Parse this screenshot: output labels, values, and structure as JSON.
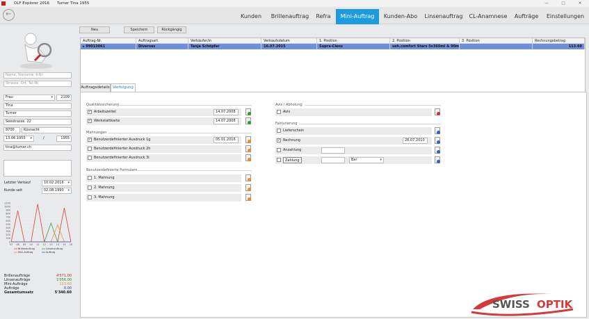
{
  "titlebar": {
    "app": "OLF Explorer 2016",
    "customer": "Turner  Tina   1955",
    "min": "—",
    "max": "□",
    "close": "✕"
  },
  "nav": {
    "back": "←",
    "tabs": [
      "Kunden",
      "Brillenauftrag",
      "Refra",
      "Mini-Auftrag",
      "Kunden-Abo",
      "Linsenauftrag",
      "CL-Anamnese",
      "Aufträge",
      "Einstellungen"
    ],
    "active": "Mini-Auftrag"
  },
  "search": {
    "name_placeholder": "Name, Vorname, K-Nr.",
    "street_placeholder": "Strasse, Ort, Tel-Nr."
  },
  "customer": {
    "salutation": "Frau",
    "number": "2109",
    "firstname": "Tina",
    "lastname": "Turner",
    "street": "Seestrasse. 22",
    "zip": "8700",
    "city": "Küsnacht",
    "birthdate": "13.06.1955",
    "slash": "/",
    "birthyear": "1955",
    "email": "tina@turner.ch"
  },
  "meta": {
    "last_sale_label": "Letzter Verkauf",
    "last_sale": "10.02.2016",
    "customer_since_label": "Kunde seit",
    "customer_since": "02.08.1990"
  },
  "chart_data": {
    "type": "line",
    "x": [
      "07",
      "08",
      "09",
      "10",
      "11",
      "12",
      "13",
      "14",
      "15",
      "16"
    ],
    "yticks": [
      0,
      100,
      200,
      300,
      400,
      500,
      600,
      700,
      800,
      900,
      1000,
      1100
    ],
    "ylim": [
      0,
      1100
    ],
    "series": [
      {
        "name": "Brillenauftrag",
        "color": "#d84040",
        "values": [
          0,
          880,
          0,
          0,
          1070,
          0,
          0,
          0,
          960,
          0
        ]
      },
      {
        "name": "Linsenauftrag",
        "color": "#3aa03a",
        "values": [
          0,
          0,
          0,
          0,
          0,
          0,
          530,
          0,
          0,
          0
        ]
      },
      {
        "name": "Mini-Auftrag",
        "color": "#e8963c",
        "values": [
          0,
          0,
          0,
          0,
          0,
          0,
          0,
          480,
          0,
          0
        ]
      },
      {
        "name": "Auftrag",
        "color": "#3a55c8",
        "values": [
          0,
          0,
          0,
          0,
          0,
          0,
          0,
          0,
          0,
          0
        ]
      }
    ]
  },
  "stats": [
    {
      "label": "Brillenaufträge",
      "value": "4'571.00",
      "color": "#c03030"
    },
    {
      "label": "Linsenaufträge",
      "value": "1'056.00",
      "color": "#2a8a2a"
    },
    {
      "label": "Mini-Aufträge",
      "value": "113.60",
      "color": "#e0902c"
    },
    {
      "label": "Aufträge",
      "value": "0.00",
      "color": "#2a3fc0"
    },
    {
      "label": "Gesamtumsatz",
      "value": "5'340.60",
      "color": "#111"
    }
  ],
  "toolbar": {
    "new": "Neu",
    "save": "Speichern",
    "undo": "Rückgängig"
  },
  "grid": {
    "headers": [
      "Auftrag-Nr.",
      "Auftragsart",
      "Verkäufer/in",
      "Verkaufsdatum",
      "1. Position",
      "2. Position",
      "3. Position",
      "Rechnungsbetrag"
    ],
    "rows": [
      [
        "99013061",
        "Diverses",
        "Tanja Schöpfer",
        "16.07.2015",
        "Supra-Clens",
        "seh.comfort Stars 5x360ml & 90ml",
        "",
        "113.60"
      ]
    ]
  },
  "detail_tabs": [
    "Auftragsdetails",
    "Verfolgung"
  ],
  "qs": {
    "title": "Qualitätssicherung",
    "rows": [
      {
        "label": "Arbeitszettel",
        "checked": "✓",
        "date": "14.07.2008"
      },
      {
        "label": "Werkstattkarte",
        "checked": "✓",
        "date": "14.07.2008"
      }
    ]
  },
  "mahn": {
    "title": "Mahnungen",
    "rows": [
      {
        "label": "Benutzerdefinierter Ausdruck 1g",
        "checked": "✓",
        "date": "05.01.2016"
      },
      {
        "label": "Benutzerdefinierter Ausdruck 2h",
        "checked": "",
        "date": ""
      },
      {
        "label": "Benutzerdefinierter Ausdruck 3i",
        "checked": "",
        "date": ""
      }
    ]
  },
  "forms": {
    "title": "Benutzerdefinierte Formulare",
    "rows": [
      "1. Mahnung",
      "2. Mahnung",
      "3. Mahnung"
    ]
  },
  "avis": {
    "title": "Avis / Abholung",
    "label": "Avis"
  },
  "fakt": {
    "title": "Fakturierung",
    "lieferschein": "Lieferschein",
    "rechnung": "Rechnung",
    "rechnung_checked": "✓",
    "rechnung_date": "28.07.2010",
    "anzahlung": "Anzahlung",
    "zahlung": "Zahlung",
    "payment_method": "Bar"
  },
  "brand": {
    "part1": "SWISS",
    "part2": "OPTIK"
  }
}
